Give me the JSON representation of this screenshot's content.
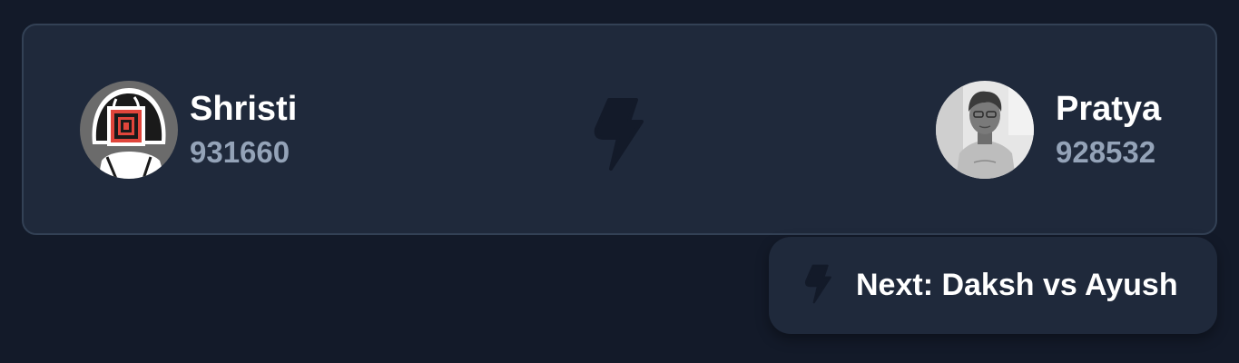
{
  "match": {
    "player_left": {
      "name": "Shristi",
      "score": "931660",
      "avatar_icon": "pixel-art-avatar"
    },
    "player_right": {
      "name": "Pratya",
      "score": "928532",
      "avatar_icon": "photo-avatar"
    },
    "vs_icon": "lightning-bolt-icon"
  },
  "next": {
    "label": "Next: Daksh vs Ayush",
    "icon": "lightning-bolt-icon"
  },
  "colors": {
    "background": "#131a29",
    "card": "#1f293b",
    "card_border": "#334155",
    "name": "#ffffff",
    "score": "#94a3b8",
    "bolt": "#131a29"
  }
}
